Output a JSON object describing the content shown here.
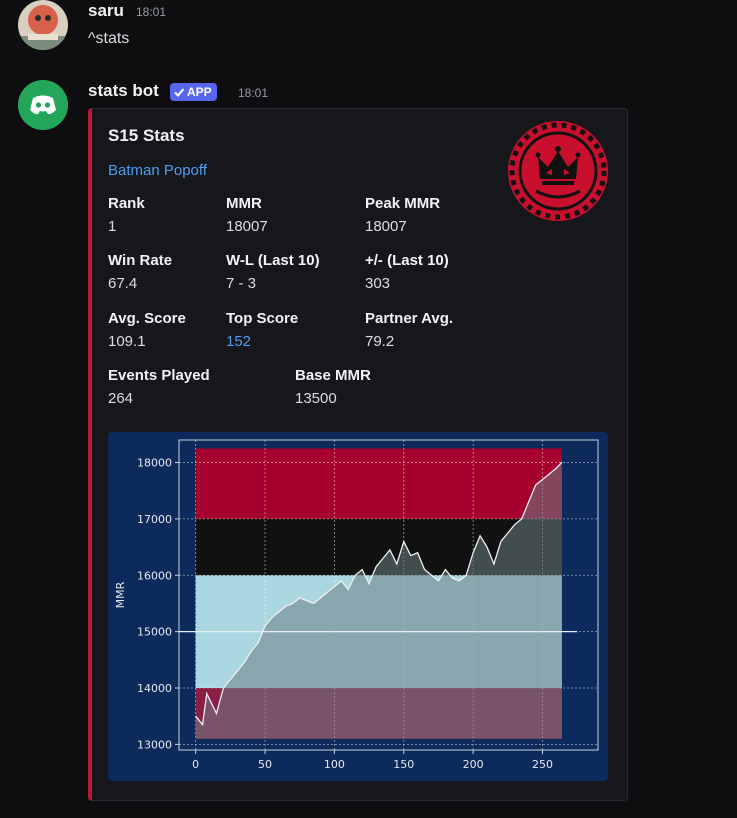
{
  "messages": [
    {
      "username": "saru",
      "time": "18:01",
      "text": "^stats"
    },
    {
      "username": "stats bot",
      "badge": "APP",
      "time": "18:01"
    }
  ],
  "embed": {
    "title": "S15 Stats",
    "player": "Batman Popoff",
    "accent_color": "#c0153a",
    "thumbnail_icon": "mario-kart-crown-logo",
    "fields": [
      {
        "name": "Rank",
        "value": "1"
      },
      {
        "name": "MMR",
        "value": "18007"
      },
      {
        "name": "Peak MMR",
        "value": "18007"
      },
      {
        "name": "Win Rate",
        "value": "67.4"
      },
      {
        "name": "W-L (Last 10)",
        "value": "7 - 3"
      },
      {
        "name": "+/- (Last 10)",
        "value": "303"
      },
      {
        "name": "Avg. Score",
        "value": "109.1"
      },
      {
        "name": "Top Score",
        "value": "152"
      },
      {
        "name": "Partner Avg.",
        "value": "79.2"
      },
      {
        "name": "Events Played",
        "value": "264"
      },
      {
        "name": "Base MMR",
        "value": "13500"
      }
    ]
  },
  "chart_data": {
    "type": "line",
    "title": "",
    "xlabel": "",
    "ylabel": "MMR",
    "xlim": [
      -12,
      290
    ],
    "ylim": [
      12900,
      18400
    ],
    "x_ticks": [
      0,
      50,
      100,
      150,
      200,
      250
    ],
    "y_ticks": [
      13000,
      14000,
      15000,
      16000,
      17000,
      18000
    ],
    "grid": true,
    "base_line": 15000,
    "rank_bands": [
      {
        "from": 13100,
        "to": 14000,
        "color": "#8a1e45"
      },
      {
        "from": 14000,
        "to": 16000,
        "color": "#aad6e0"
      },
      {
        "from": 16000,
        "to": 17000,
        "color": "#111111"
      },
      {
        "from": 17000,
        "to": 18250,
        "color": "#a5002e"
      }
    ],
    "series": [
      {
        "x": [
          0,
          5,
          8,
          12,
          15,
          20,
          25,
          30,
          35,
          40,
          45,
          50,
          55,
          60,
          65,
          70,
          75,
          80,
          85,
          90,
          95,
          100,
          105,
          110,
          115,
          120,
          125,
          130,
          135,
          140,
          145,
          150,
          155,
          160,
          165,
          170,
          175,
          180,
          185,
          190,
          195,
          200,
          205,
          210,
          215,
          220,
          225,
          230,
          235,
          240,
          245,
          250,
          255,
          260,
          264
        ],
        "y": [
          13500,
          13350,
          13900,
          13700,
          13550,
          14000,
          14150,
          14300,
          14450,
          14650,
          14800,
          15100,
          15250,
          15350,
          15450,
          15500,
          15600,
          15550,
          15500,
          15600,
          15700,
          15800,
          15900,
          15750,
          16000,
          16100,
          15850,
          16150,
          16300,
          16450,
          16200,
          16600,
          16350,
          16400,
          16100,
          16000,
          15900,
          16100,
          15950,
          15900,
          16000,
          16400,
          16700,
          16500,
          16200,
          16600,
          16750,
          16900,
          17000,
          17300,
          17600,
          17700,
          17800,
          17900,
          18007
        ]
      }
    ]
  }
}
